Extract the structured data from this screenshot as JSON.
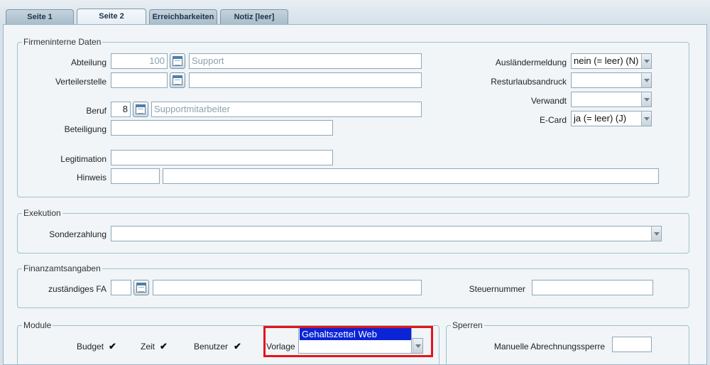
{
  "tabs": [
    "Seite 1",
    "Seite 2",
    "Erreichbarkeiten",
    "Notiz [leer]"
  ],
  "firmeninterne": {
    "title": "Firmeninterne Daten",
    "abteilung_label": "Abteilung",
    "abteilung_nr": "100",
    "abteilung_name": "Support",
    "verteilerstelle_label": "Verteilerstelle",
    "beruf_label": "Beruf",
    "beruf_nr": "8",
    "beruf_name": "Supportmitarbeiter",
    "beteiligung_label": "Beteiligung",
    "legitimation_label": "Legitimation",
    "hinweis_label": "Hinweis",
    "auslaendermeldung_label": "Ausländermeldung",
    "auslaendermeldung_value": "nein (= leer) (N)",
    "resturlaub_label": "Resturlaubsandruck",
    "verwandt_label": "Verwandt",
    "ecard_label": "E-Card",
    "ecard_value": "ja (= leer) (J)"
  },
  "exekution": {
    "title": "Exekution",
    "sonderzahlung_label": "Sonderzahlung"
  },
  "finanzamt": {
    "title": "Finanzamtsangaben",
    "fa_label": "zuständiges FA",
    "steuernummer_label": "Steuernummer"
  },
  "module": {
    "title": "Module",
    "budget_label": "Budget",
    "zeit_label": "Zeit",
    "benutzer_label": "Benutzer",
    "vorlage_label": "Vorlage",
    "check_mark": "✔",
    "vorlage_option": "Gehaltszettel Web"
  },
  "sperren": {
    "title": "Sperren",
    "abrechnungssperre_label": "Manuelle Abrechnungssperre"
  },
  "colors": {
    "highlight": "#e3151a",
    "selected_option": "#0a24d6"
  }
}
